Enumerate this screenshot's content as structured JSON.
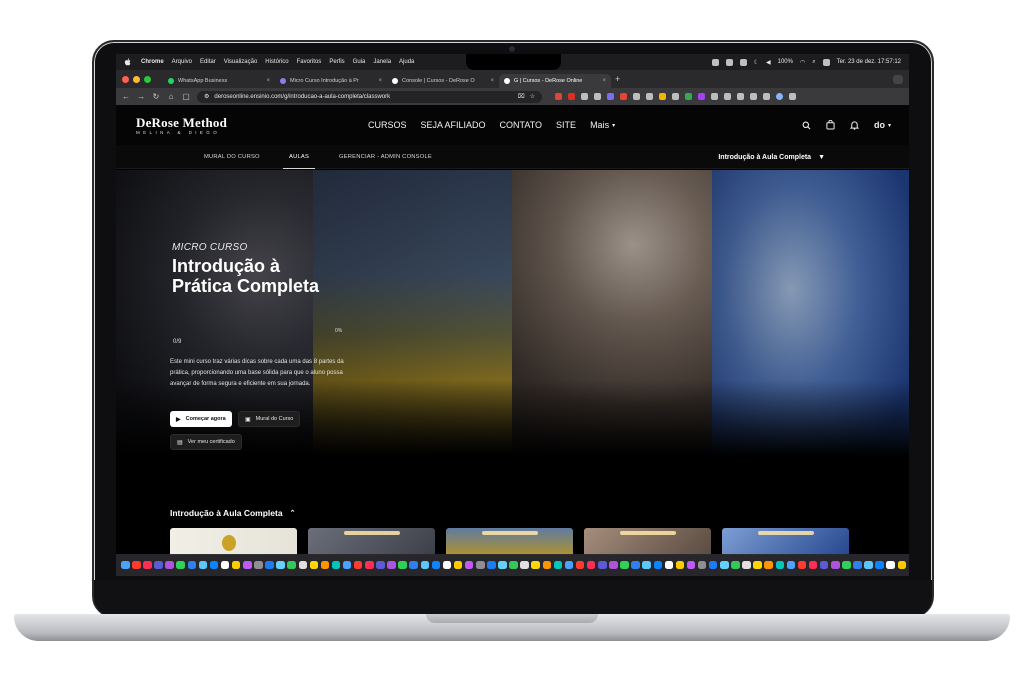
{
  "menubar": {
    "app": "Chrome",
    "menus": [
      "Arquivo",
      "Editar",
      "Visualização",
      "Histórico",
      "Favoritos",
      "Perfis",
      "Guia",
      "Janela",
      "Ajuda"
    ],
    "battery": "100%",
    "datetime": "Ter. 23 de dez.  17:57:12"
  },
  "tabs": [
    {
      "label": "WhatsApp Business",
      "favicon_color": "#25d366",
      "active": false
    },
    {
      "label": "Micro Curso Introdução à Pr",
      "favicon_color": "#8c7cf0",
      "active": false
    },
    {
      "label": "Console | Cursos - DeRose O",
      "favicon_color": "#ffffff",
      "active": false
    },
    {
      "label": "G | Cursos - DeRose Online",
      "favicon_color": "#ffffff",
      "active": true
    }
  ],
  "addressbar": {
    "url": "deroseonline.ensinio.com/g/introducao-a-aula-completa/classwork"
  },
  "site": {
    "brand_name": "DeRose Method",
    "brand_sub": "MELINA & DIEGO",
    "nav": [
      "CURSOS",
      "SEJA AFILIADO",
      "CONTATO",
      "SITE"
    ],
    "nav_more": "Mais",
    "user_initials": "do"
  },
  "subnav": {
    "items": [
      "MURAL DO CURSO",
      "AULAS",
      "GERENCIAR - ADMIN CONSOLE"
    ],
    "active": "AULAS",
    "course_select": "Introdução à Aula Completa"
  },
  "hero": {
    "kicker": "MICRO CURSO",
    "title_line1": "Introdução à",
    "title_line2": "Prática Completa",
    "progress_count": "0/9",
    "progress_percent": "0%",
    "description": "Este mini curso traz várias dicas sobre cada uma das 8 partes da prática, proporcionando uma base sólida para que o aluno possa avançar de forma segura e eficiente em sua jornada.",
    "start_button": "Começar agora",
    "wall_button": "Mural do Curso",
    "certificate_button": "Ver meu certificado"
  },
  "lessons": {
    "title": "Introdução à Aula Completa"
  },
  "colors": {
    "background": "#000000",
    "accent": "#ffffff"
  }
}
